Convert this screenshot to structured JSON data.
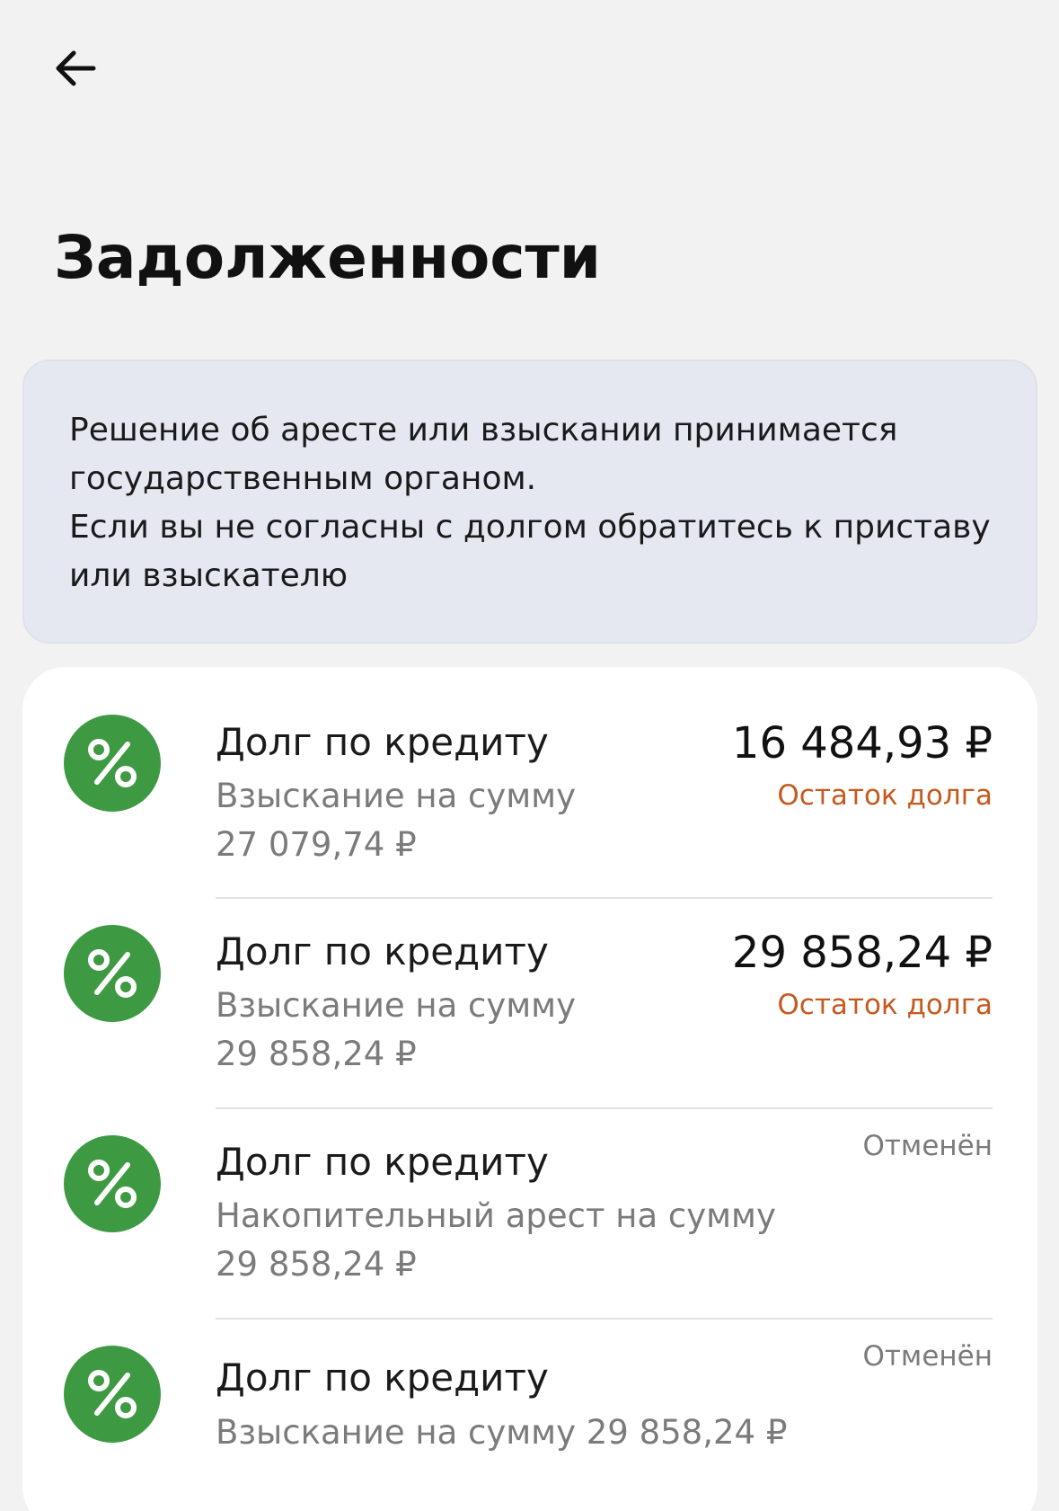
{
  "header": {
    "back_icon": "arrow-left-icon",
    "title": "Задолженности"
  },
  "notice": {
    "lines": [
      "Решение об аресте или взыскании принимается",
      "государственным органом.",
      "Если вы не согласны с долгом обратитесь к приставу",
      "или взыскателю"
    ]
  },
  "debts": [
    {
      "icon": "percent-icon",
      "title": "Долг по кредиту",
      "desc_line1": "Взыскание на сумму",
      "desc_line2": "27 079,74 ₽",
      "amount": "16 484,93 ₽",
      "status": "Остаток долга"
    },
    {
      "icon": "percent-icon",
      "title": "Долг по кредиту",
      "desc_line1": "Взыскание на сумму",
      "desc_line2": "29 858,24 ₽",
      "amount": "29 858,24 ₽",
      "status": "Остаток долга"
    },
    {
      "icon": "percent-icon",
      "title": "Долг по кредиту",
      "desc_line1": "Накопительный арест на сумму",
      "desc_line2": "29 858,24 ₽",
      "status": "Отменён"
    },
    {
      "icon": "percent-icon",
      "title": "Долг по кредиту",
      "desc_line1": "Взыскание на сумму 29 858,24 ₽",
      "status": "Отменён"
    }
  ],
  "colors": {
    "icon_green": "#3e9a42",
    "status_orange": "#c45a1f",
    "notice_bg": "#e5e8f0",
    "page_bg": "#f2f2f2"
  }
}
